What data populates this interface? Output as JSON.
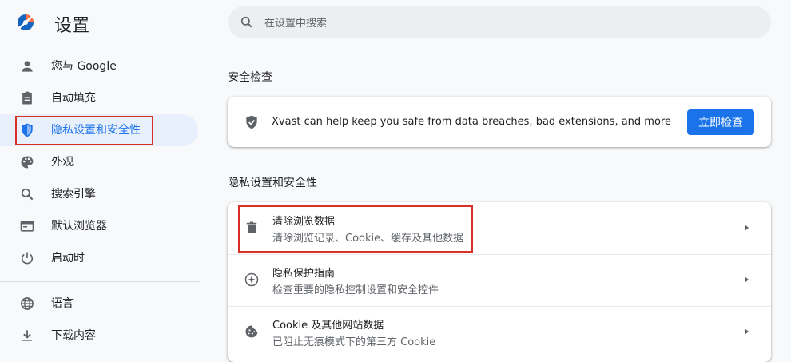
{
  "app": {
    "title": "设置"
  },
  "search": {
    "placeholder": "在设置中搜索"
  },
  "sidebar": {
    "items": [
      {
        "label": "您与 Google",
        "icon": "person-icon"
      },
      {
        "label": "自动填充",
        "icon": "clipboard-icon"
      },
      {
        "label": "隐私设置和安全性",
        "icon": "shield-icon",
        "active": true
      },
      {
        "label": "外观",
        "icon": "palette-icon"
      },
      {
        "label": "搜索引擎",
        "icon": "search-icon"
      },
      {
        "label": "默认浏览器",
        "icon": "browser-window-icon"
      },
      {
        "label": "启动时",
        "icon": "power-icon"
      },
      {
        "label": "语言",
        "icon": "globe-icon"
      },
      {
        "label": "下载内容",
        "icon": "download-icon"
      }
    ]
  },
  "safety_check": {
    "title": "安全检查",
    "description": "Xvast can help keep you safe from data breaches, bad extensions, and more",
    "button": "立即检查"
  },
  "privacy": {
    "title": "隐私设置和安全性",
    "rows": [
      {
        "title": "清除浏览数据",
        "subtitle": "清除浏览记录、Cookie、缓存及其他数据",
        "icon": "trash-icon"
      },
      {
        "title": "隐私保护指南",
        "subtitle": "检查重要的隐私控制设置和安全控件",
        "icon": "compass-icon"
      },
      {
        "title": "Cookie 及其他网站数据",
        "subtitle": "已阻止无痕模式下的第三方 Cookie",
        "icon": "cookie-icon"
      }
    ]
  },
  "colors": {
    "accent": "#1a73e8",
    "active_bg": "#e8f0fe",
    "highlight": "#d93025"
  }
}
